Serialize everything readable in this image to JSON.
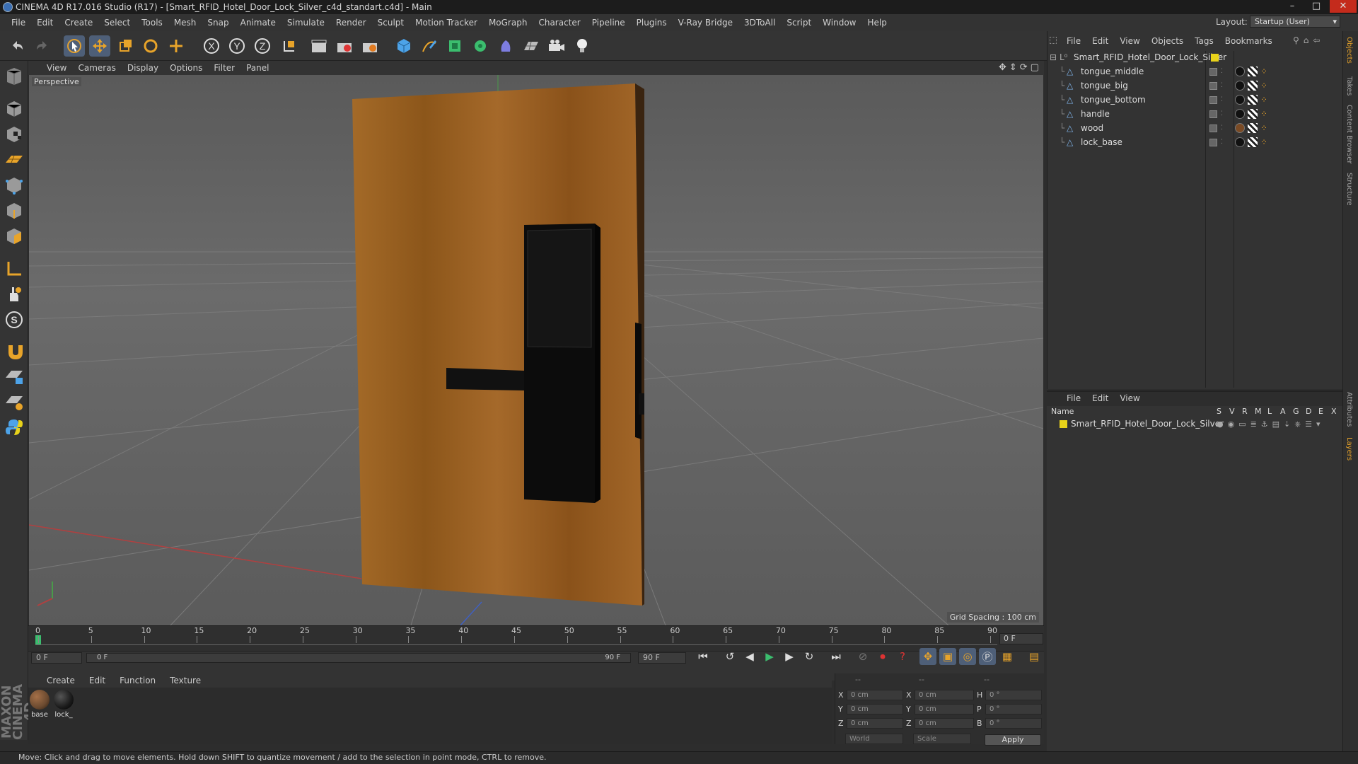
{
  "window": {
    "title": "CINEMA 4D R17.016 Studio (R17) - [Smart_RFID_Hotel_Door_Lock_Silver_c4d_standart.c4d] - Main",
    "controls": [
      "–",
      "□",
      "✕"
    ]
  },
  "menubar": [
    "File",
    "Edit",
    "Create",
    "Select",
    "Tools",
    "Mesh",
    "Snap",
    "Animate",
    "Simulate",
    "Render",
    "Sculpt",
    "Motion Tracker",
    "MoGraph",
    "Character",
    "Pipeline",
    "Plugins",
    "V-Ray Bridge",
    "3DToAll",
    "Script",
    "Window",
    "Help"
  ],
  "layout": {
    "label": "Layout:",
    "value": "Startup (User)"
  },
  "viewport": {
    "menu": [
      "View",
      "Cameras",
      "Display",
      "Options",
      "Filter",
      "Panel"
    ],
    "label": "Perspective",
    "grid_spacing": "Grid Spacing : 100 cm"
  },
  "timeline": {
    "ticks": [
      "0",
      "5",
      "10",
      "15",
      "20",
      "25",
      "30",
      "35",
      "40",
      "45",
      "50",
      "55",
      "60",
      "65",
      "70",
      "75",
      "80",
      "85",
      "90"
    ],
    "current_frame": "0 F",
    "start_field": "0 F",
    "range_start": "0 F",
    "range_end": "90 F",
    "end_field": "90 F"
  },
  "material_manager": {
    "menu": [
      "Create",
      "Edit",
      "Function",
      "Texture"
    ],
    "materials": [
      {
        "label": "base",
        "color": "#6b4a30"
      },
      {
        "label": "lock_",
        "color": "#1a1a1a"
      }
    ]
  },
  "coordinates": {
    "header": [
      "--",
      "--",
      "--"
    ],
    "rows": [
      {
        "axis": "X",
        "pos": "0 cm",
        "axis2": "X",
        "size": "0 cm",
        "axis3": "H",
        "rot": "0 °"
      },
      {
        "axis": "Y",
        "pos": "0 cm",
        "axis2": "Y",
        "size": "0 cm",
        "axis3": "P",
        "rot": "0 °"
      },
      {
        "axis": "Z",
        "pos": "0 cm",
        "axis2": "Z",
        "size": "0 cm",
        "axis3": "B",
        "rot": "0 °"
      }
    ],
    "mode1": "World",
    "mode2": "Scale",
    "apply": "Apply"
  },
  "object_manager": {
    "menu": [
      "File",
      "Edit",
      "View",
      "Objects",
      "Tags",
      "Bookmarks"
    ],
    "root": "Smart_RFID_Hotel_Door_Lock_Silver",
    "objects": [
      "tongue_middle",
      "tongue_big",
      "tongue_bottom",
      "handle",
      "wood",
      "lock_base"
    ]
  },
  "layer_manager": {
    "menu": [
      "File",
      "Edit",
      "View"
    ],
    "columns": [
      "Name",
      "S",
      "V",
      "R",
      "M",
      "L",
      "A",
      "G",
      "D",
      "E",
      "X"
    ],
    "layer": "Smart_RFID_Hotel_Door_Lock_Silver"
  },
  "right_tabs": [
    "Objects",
    "Takes",
    "Content Browser",
    "Structure",
    "Attributes",
    "Layers"
  ],
  "brand": "MAXON CINEMA 4D",
  "status": "Move: Click and drag to move elements. Hold down SHIFT to quantize movement / add to the selection in point mode, CTRL to remove.",
  "colors": {
    "accent": "#4e5f78",
    "layer_color": "#e8d21a",
    "wood": "#9a6220"
  }
}
